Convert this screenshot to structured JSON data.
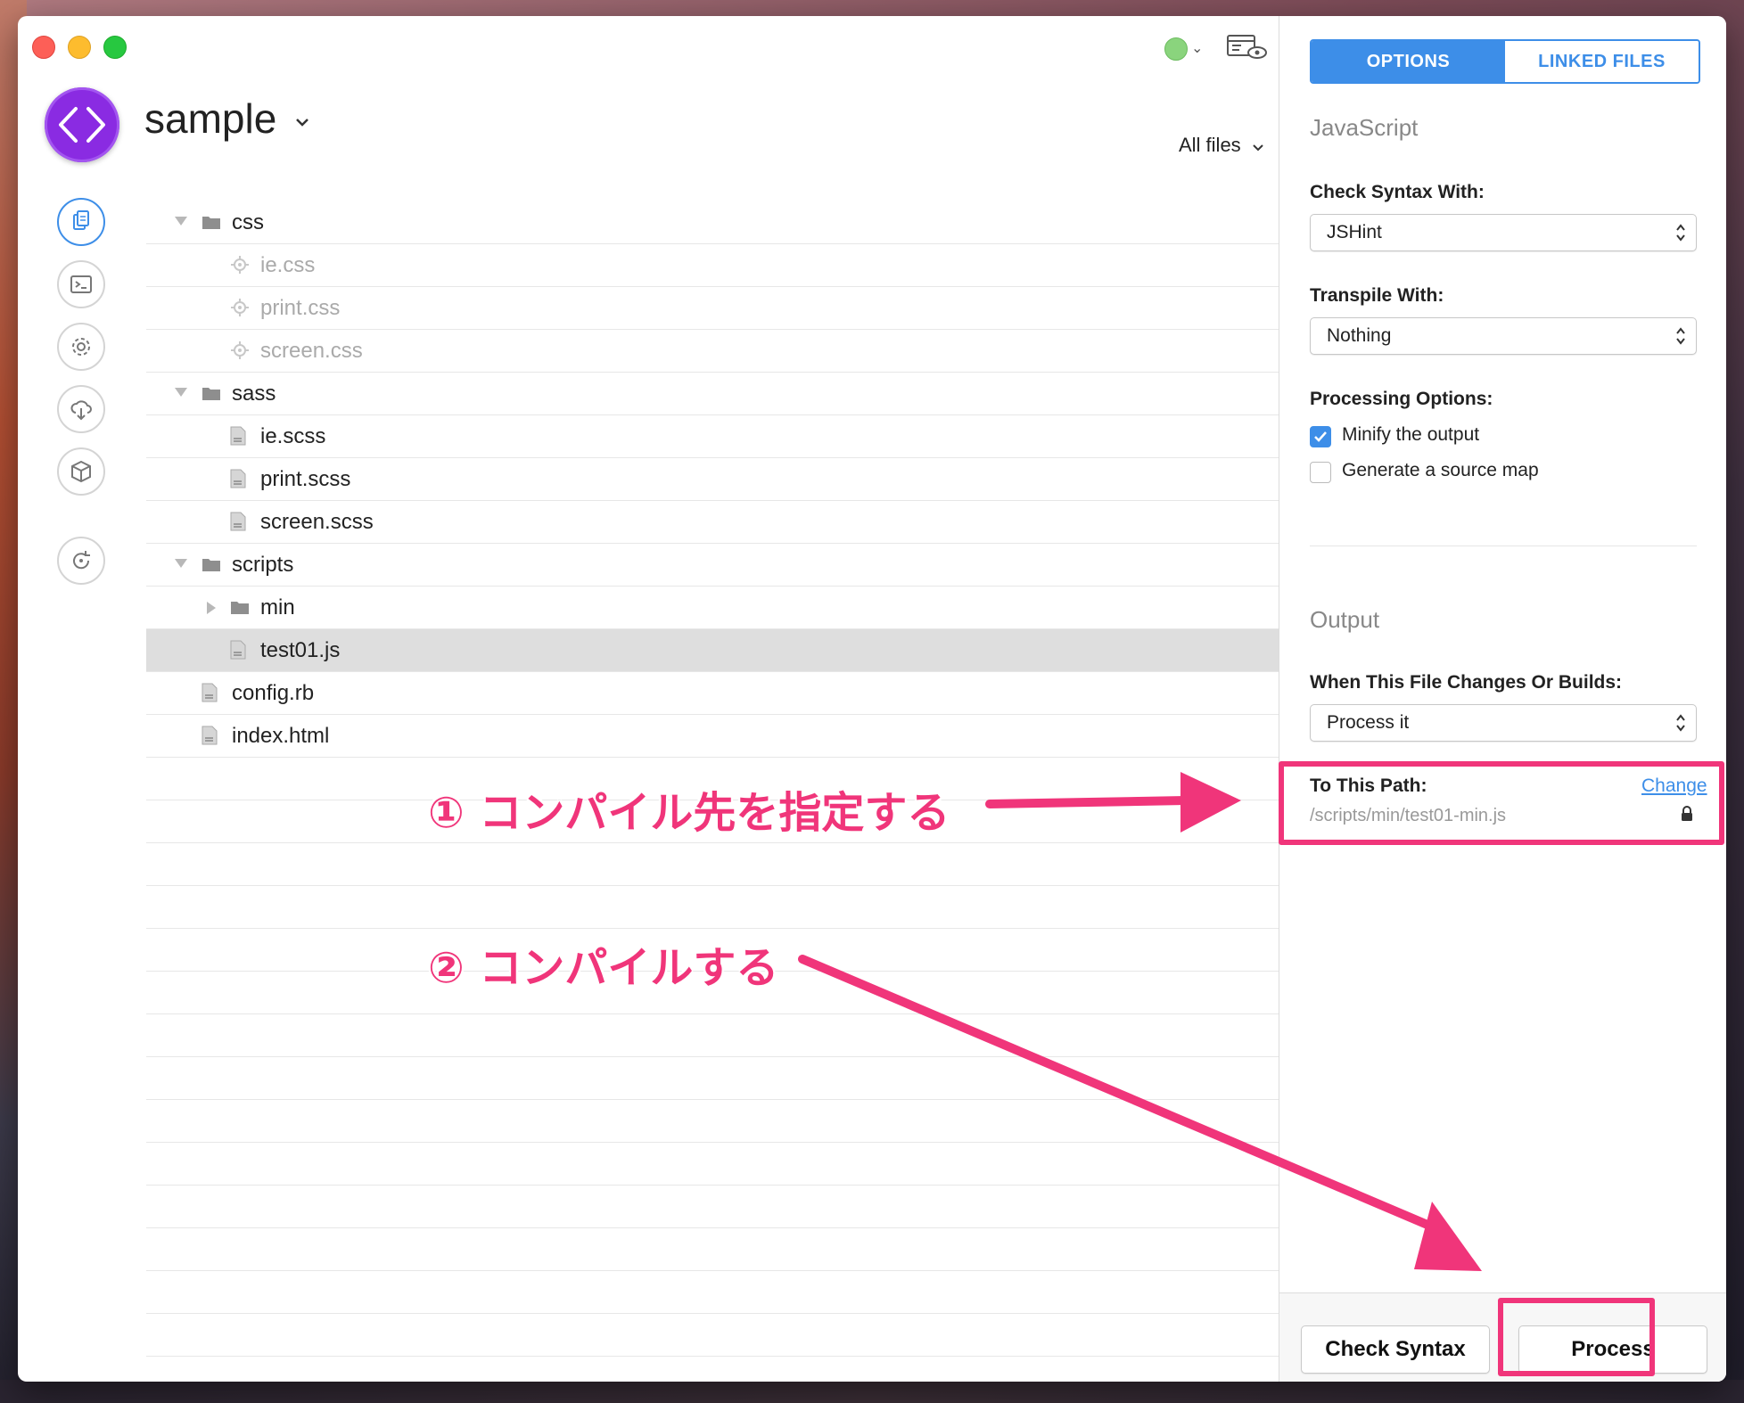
{
  "project": {
    "name": "sample",
    "filter_label": "All files"
  },
  "tree": [
    {
      "name": "css",
      "type": "folder",
      "depth": 0,
      "state": "expanded",
      "dim": false,
      "selected": false
    },
    {
      "name": "ie.css",
      "type": "generated",
      "depth": 1,
      "state": "",
      "dim": true,
      "selected": false
    },
    {
      "name": "print.css",
      "type": "generated",
      "depth": 1,
      "state": "",
      "dim": true,
      "selected": false
    },
    {
      "name": "screen.css",
      "type": "generated",
      "depth": 1,
      "state": "",
      "dim": true,
      "selected": false
    },
    {
      "name": "sass",
      "type": "folder",
      "depth": 0,
      "state": "expanded",
      "dim": false,
      "selected": false
    },
    {
      "name": "ie.scss",
      "type": "file",
      "depth": 1,
      "state": "",
      "dim": false,
      "selected": false
    },
    {
      "name": "print.scss",
      "type": "file",
      "depth": 1,
      "state": "",
      "dim": false,
      "selected": false
    },
    {
      "name": "screen.scss",
      "type": "file",
      "depth": 1,
      "state": "",
      "dim": false,
      "selected": false
    },
    {
      "name": "scripts",
      "type": "folder",
      "depth": 0,
      "state": "expanded",
      "dim": false,
      "selected": false
    },
    {
      "name": "min",
      "type": "folder",
      "depth": 1,
      "state": "collapsed",
      "dim": false,
      "selected": false
    },
    {
      "name": "test01.js",
      "type": "file",
      "depth": 1,
      "state": "",
      "dim": false,
      "selected": true
    },
    {
      "name": "config.rb",
      "type": "file",
      "depth": 0,
      "state": "",
      "dim": false,
      "selected": false
    },
    {
      "name": "index.html",
      "type": "file",
      "depth": 0,
      "state": "",
      "dim": false,
      "selected": false
    }
  ],
  "sidebar_icons": [
    "files-icon",
    "terminal-icon",
    "settings-icon",
    "cloud-sync-icon",
    "package-icon",
    "refresh-icon"
  ],
  "panel": {
    "tabs": {
      "options": "OPTIONS",
      "linked_files": "LINKED FILES"
    },
    "section_language": "JavaScript",
    "check_syntax_label": "Check Syntax With:",
    "check_syntax_value": "JSHint",
    "transpile_label": "Transpile With:",
    "transpile_value": "Nothing",
    "processing_label": "Processing Options:",
    "minify_label": "Minify the output",
    "minify_checked": true,
    "sourcemap_label": "Generate a source map",
    "sourcemap_checked": false,
    "section_output": "Output",
    "when_changes_label": "When This File Changes Or Builds:",
    "when_changes_value": "Process it",
    "path_label": "To This Path:",
    "change_link": "Change",
    "path_value": "/scripts/min/test01-min.js",
    "check_syntax_button": "Check Syntax",
    "process_button": "Process"
  },
  "annotations": {
    "step1": "① コンパイル先を指定する",
    "step2": "② コンパイルする",
    "color": "#f0357a"
  },
  "colors": {
    "accent": "#3d8ee8",
    "logo": "#8a2be2",
    "status": "#8ad47d"
  }
}
